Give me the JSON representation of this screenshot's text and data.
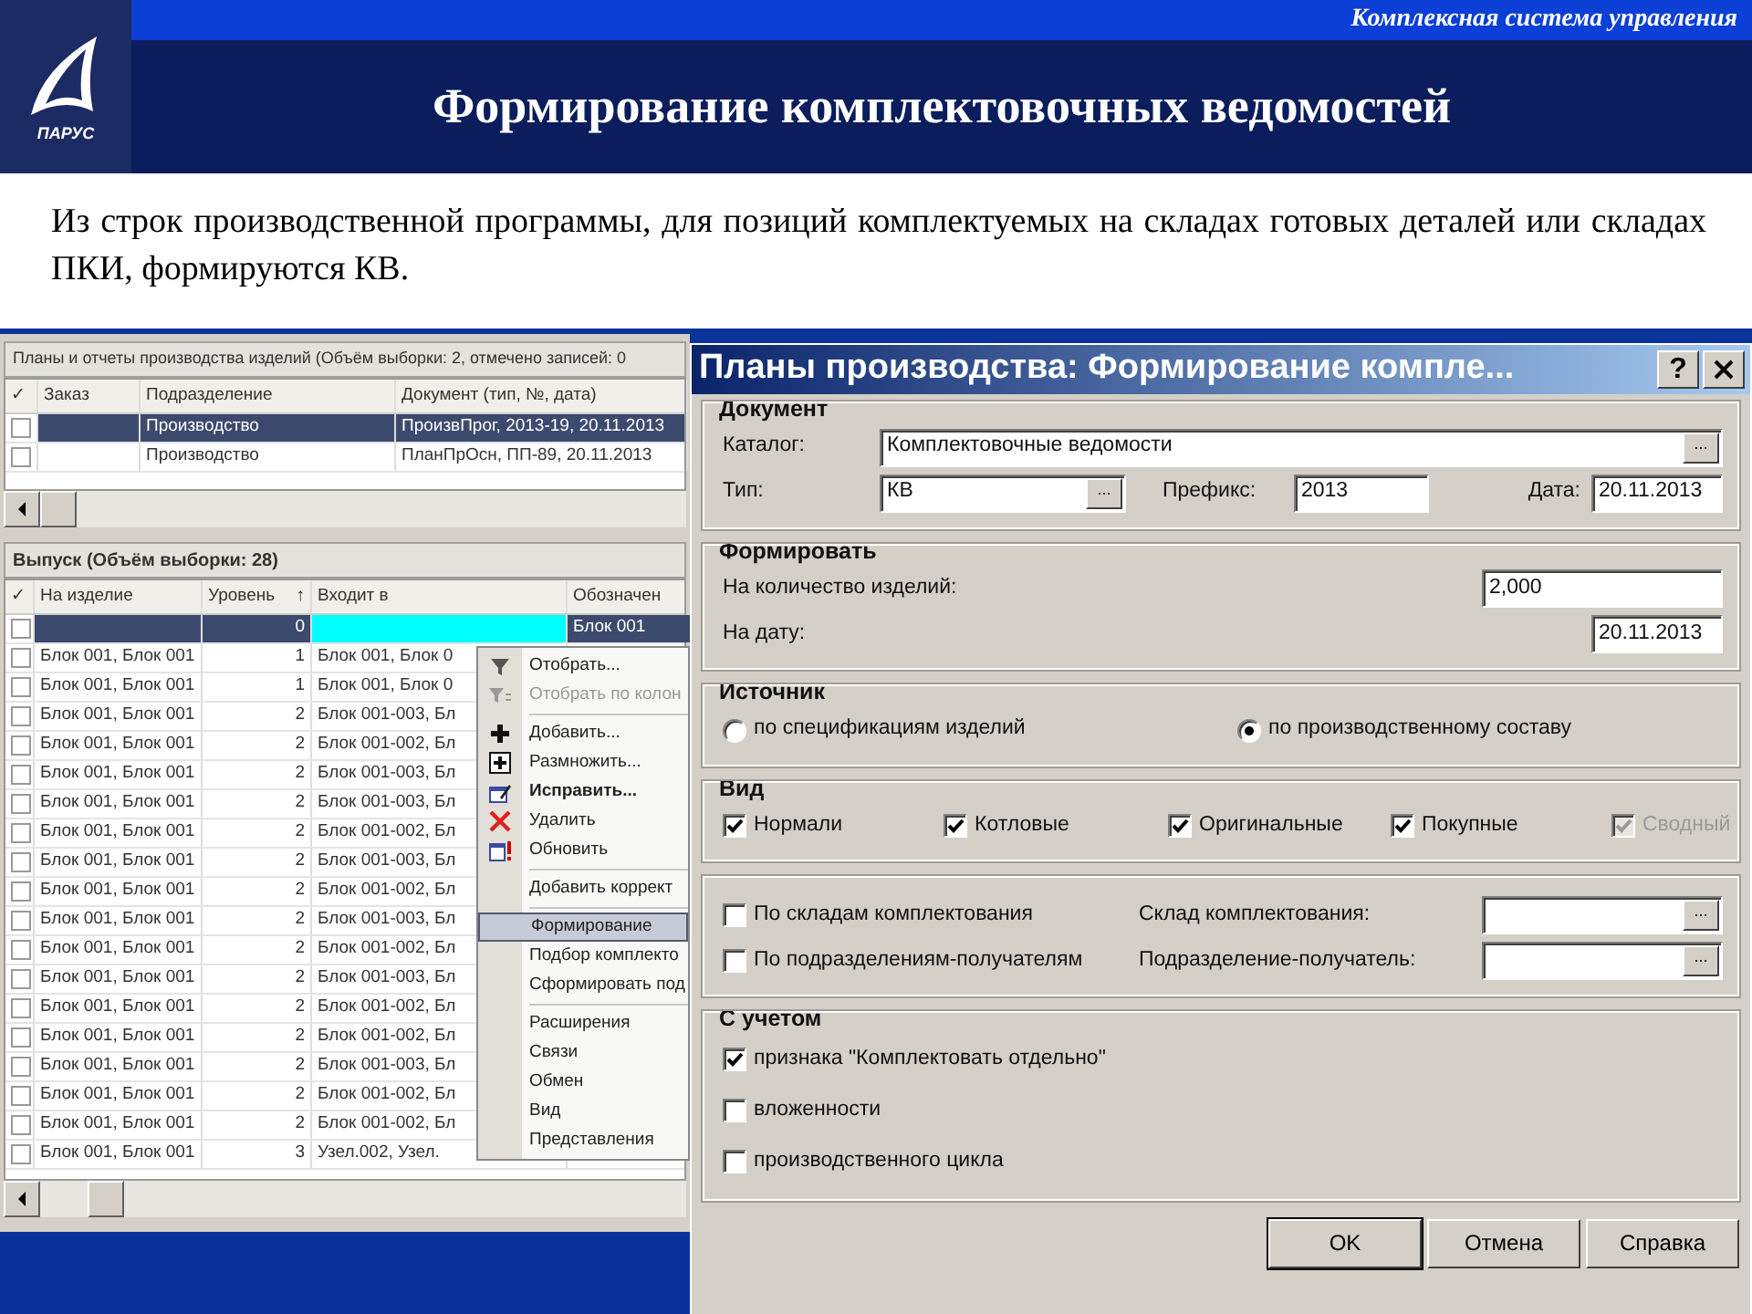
{
  "slide": {
    "logo_text": "ПАРУС",
    "tagline": "Комплексная система управления",
    "title": "Формирование комплектовочных ведомостей",
    "intro": "Из строк производственной программы, для позиций комплектуемых на складах готовых деталей или складах ПКИ, формируются КВ."
  },
  "plans": {
    "title": "Планы и отчеты производства изделий (Объём выборки: 2, отмечено записей: 0",
    "check_header": "✓",
    "columns": [
      "Заказ",
      "Подразделение",
      "Документ (тип, №, дата)"
    ],
    "rows": [
      {
        "checked": false,
        "selected": true,
        "cells": [
          "",
          "Производство",
          "ПроизвПрог, 2013-19, 20.11.2013"
        ]
      },
      {
        "checked": false,
        "selected": false,
        "cells": [
          "",
          "Производство",
          "ПланПрОсн, ПП-89, 20.11.2013"
        ]
      }
    ]
  },
  "output": {
    "title": "Выпуск (Объём выборки: 28)",
    "check_header": "✓",
    "columns": [
      {
        "label": "На изделие",
        "cursor": false
      },
      {
        "label": "Уровень",
        "sort": "↑",
        "cursor": false
      },
      {
        "label": "Входит в",
        "cursor": true
      },
      {
        "label": "Обозначен",
        "cursor": false
      }
    ],
    "rows": [
      {
        "checked": false,
        "selected": true,
        "cells": [
          "",
          "0",
          "",
          "Блок 001"
        ]
      },
      {
        "checked": false,
        "selected": false,
        "cells": [
          "Блок 001, Блок 001",
          "1",
          "Блок 001, Блок 0",
          ""
        ]
      },
      {
        "checked": false,
        "selected": false,
        "cells": [
          "Блок 001, Блок 001",
          "1",
          "Блок 001, Блок 0",
          ""
        ]
      },
      {
        "checked": false,
        "selected": false,
        "cells": [
          "Блок 001, Блок 001",
          "2",
          "Блок 001-003, Бл",
          ""
        ]
      },
      {
        "checked": false,
        "selected": false,
        "cells": [
          "Блок 001, Блок 001",
          "2",
          "Блок 001-002, Бл",
          ""
        ]
      },
      {
        "checked": false,
        "selected": false,
        "cells": [
          "Блок 001, Блок 001",
          "2",
          "Блок 001-003, Бл",
          ""
        ]
      },
      {
        "checked": false,
        "selected": false,
        "cells": [
          "Блок 001, Блок 001",
          "2",
          "Блок 001-003, Бл",
          ""
        ]
      },
      {
        "checked": false,
        "selected": false,
        "cells": [
          "Блок 001, Блок 001",
          "2",
          "Блок 001-002, Бл",
          ""
        ]
      },
      {
        "checked": false,
        "selected": false,
        "cells": [
          "Блок 001, Блок 001",
          "2",
          "Блок 001-003, Бл",
          ""
        ]
      },
      {
        "checked": false,
        "selected": false,
        "cells": [
          "Блок 001, Блок 001",
          "2",
          "Блок 001-002, Бл",
          ""
        ]
      },
      {
        "checked": false,
        "selected": false,
        "cells": [
          "Блок 001, Блок 001",
          "2",
          "Блок 001-003, Бл",
          ""
        ]
      },
      {
        "checked": false,
        "selected": false,
        "cells": [
          "Блок 001, Блок 001",
          "2",
          "Блок 001-002, Бл",
          ""
        ]
      },
      {
        "checked": false,
        "selected": false,
        "cells": [
          "Блок 001, Блок 001",
          "2",
          "Блок 001-003, Бл",
          ""
        ]
      },
      {
        "checked": false,
        "selected": false,
        "cells": [
          "Блок 001, Блок 001",
          "2",
          "Блок 001-002, Бл",
          ""
        ]
      },
      {
        "checked": false,
        "selected": false,
        "cells": [
          "Блок 001, Блок 001",
          "2",
          "Блок 001-002, Бл",
          ""
        ]
      },
      {
        "checked": false,
        "selected": false,
        "cells": [
          "Блок 001, Блок 001",
          "2",
          "Блок 001-003, Бл",
          ""
        ]
      },
      {
        "checked": false,
        "selected": false,
        "cells": [
          "Блок 001, Блок 001",
          "2",
          "Блок 001-002, Бл",
          ""
        ]
      },
      {
        "checked": false,
        "selected": false,
        "cells": [
          "Блок 001, Блок 001",
          "2",
          "Блок 001-002, Бл",
          ""
        ]
      },
      {
        "checked": false,
        "selected": false,
        "cells": [
          "Блок 001, Блок 001",
          "3",
          "Узел.002, Узел.",
          ""
        ]
      }
    ]
  },
  "context_menu": [
    {
      "kind": "item",
      "label": "Отобрать...",
      "disabled": false,
      "default": false,
      "selected": false
    },
    {
      "kind": "item",
      "label": "Отобрать по колон",
      "disabled": true,
      "default": false,
      "selected": false
    },
    {
      "kind": "separator"
    },
    {
      "kind": "item",
      "label": "Добавить...",
      "disabled": false,
      "default": false,
      "selected": false
    },
    {
      "kind": "item",
      "label": "Размножить...",
      "disabled": false,
      "default": false,
      "selected": false
    },
    {
      "kind": "item",
      "label": "Исправить...",
      "disabled": false,
      "default": true,
      "selected": false
    },
    {
      "kind": "item",
      "label": "Удалить",
      "disabled": false,
      "default": false,
      "selected": false
    },
    {
      "kind": "item",
      "label": "Обновить",
      "disabled": false,
      "default": false,
      "selected": false
    },
    {
      "kind": "separator"
    },
    {
      "kind": "item",
      "label": "Добавить коррект",
      "disabled": false,
      "default": false,
      "selected": false
    },
    {
      "kind": "separator"
    },
    {
      "kind": "item",
      "label": "Формирование",
      "disabled": false,
      "default": false,
      "selected": true
    },
    {
      "kind": "item",
      "label": "Подбор комплекто",
      "disabled": false,
      "default": false,
      "selected": false
    },
    {
      "kind": "item",
      "label": "Сформировать под",
      "disabled": false,
      "default": false,
      "selected": false
    },
    {
      "kind": "separator"
    },
    {
      "kind": "item",
      "label": "Расширения",
      "disabled": false,
      "default": false,
      "selected": false
    },
    {
      "kind": "item",
      "label": "Связи",
      "disabled": false,
      "default": false,
      "selected": false
    },
    {
      "kind": "item",
      "label": "Обмен",
      "disabled": false,
      "default": false,
      "selected": false
    },
    {
      "kind": "item",
      "label": "Вид",
      "disabled": false,
      "default": false,
      "selected": false
    },
    {
      "kind": "item",
      "label": "Представления",
      "disabled": false,
      "default": false,
      "selected": false
    }
  ],
  "dialog": {
    "title": "Планы производства: Формирование компле...",
    "help": "?",
    "document": {
      "legend": "Документ",
      "catalog": {
        "label": "Каталог:",
        "value": "Комплектовочные ведомости",
        "browse": "..."
      },
      "type": {
        "label": "Тип:",
        "value": "КВ",
        "browse": "..."
      },
      "prefix": {
        "label": "Префикс:",
        "value": "2013"
      },
      "date": {
        "label": "Дата:",
        "value": "20.11.2013"
      }
    },
    "form": {
      "legend": "Формировать",
      "quantity": {
        "label": "На количество изделий:",
        "value": "2,000"
      },
      "on_date": {
        "label": "На дату:",
        "value": "20.11.2013"
      }
    },
    "source": {
      "legend": "Источник",
      "options": [
        {
          "label": "по спецификациям изделий",
          "selected": false
        },
        {
          "label": "по производственному составу",
          "selected": true
        }
      ]
    },
    "view": {
      "legend": "Вид",
      "options": [
        {
          "label": "Нормали",
          "checked": true,
          "disabled": false
        },
        {
          "label": "Котловые",
          "checked": true,
          "disabled": false
        },
        {
          "label": "Оригинальные",
          "checked": true,
          "disabled": false
        },
        {
          "label": "Покупные",
          "checked": true,
          "disabled": false
        },
        {
          "label": "Сводный",
          "checked": true,
          "disabled": true
        }
      ]
    },
    "filters": [
      {
        "label": "По складам комплектования",
        "checked": false,
        "field_label": "Склад комплектования:",
        "browse": "..."
      },
      {
        "label": "По подразделениям-получателям",
        "checked": false,
        "field_label": "Подразделение-получатель:",
        "browse": "..."
      }
    ],
    "consider": {
      "legend": "С учетом",
      "options": [
        {
          "label": "признака \"Комплектовать отдельно\"",
          "checked": true
        },
        {
          "label": "вложенности",
          "checked": false
        },
        {
          "label": "производственного цикла",
          "checked": false
        }
      ]
    },
    "buttons": [
      {
        "label": "OK",
        "default": true
      },
      {
        "label": "Отмена",
        "default": false
      },
      {
        "label": "Справка",
        "default": false
      }
    ]
  }
}
